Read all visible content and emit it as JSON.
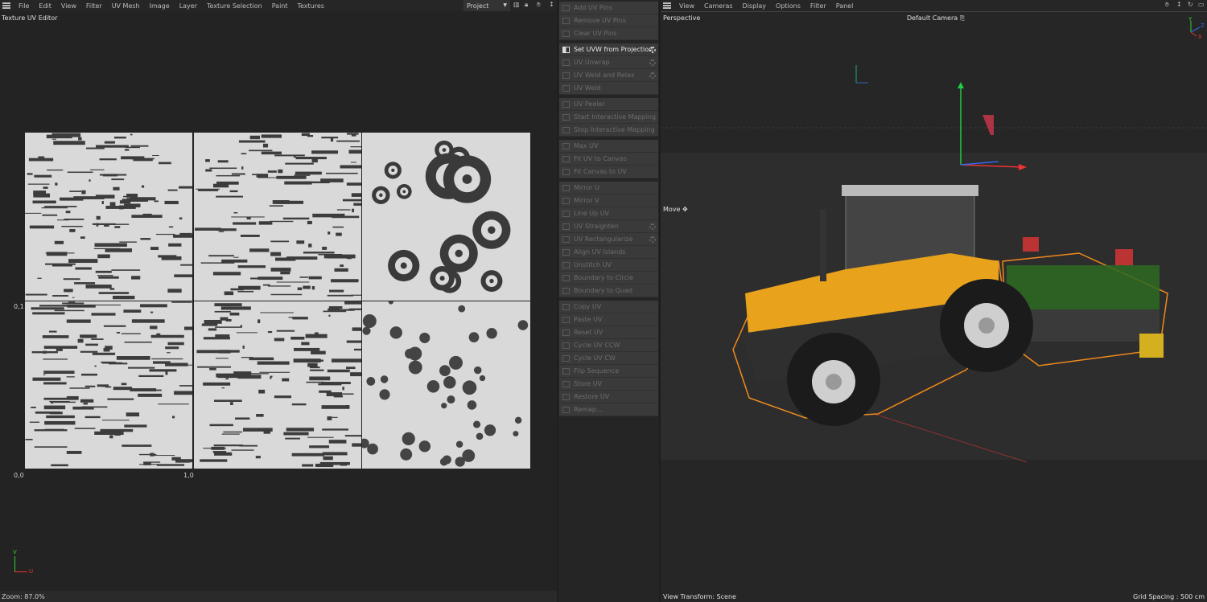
{
  "uv_editor": {
    "menu": [
      "File",
      "Edit",
      "View",
      "Filter",
      "UV Mesh",
      "Image",
      "Layer",
      "Texture Selection",
      "Paint",
      "Textures"
    ],
    "project_dropdown": "Project",
    "title": "Texture UV Editor",
    "axis_labels": {
      "origin": "0,0",
      "u_one": "1,0",
      "v_one": "0,1"
    },
    "axis_gizmo": {
      "u": "U",
      "v": "V"
    },
    "zoom": "Zoom: 87.0%"
  },
  "commands": {
    "groups": [
      [
        {
          "label": "Add UV Pins"
        },
        {
          "label": "Remove UV Pins"
        },
        {
          "label": "Clear UV Pins"
        }
      ],
      [
        {
          "label": "Set UVW from Projection",
          "active": true,
          "gear": true
        },
        {
          "label": "UV Unwrap",
          "gear": true
        },
        {
          "label": "UV Weld and Relax",
          "gear": true
        },
        {
          "label": "UV Weld"
        }
      ],
      [
        {
          "label": "UV Peeler"
        },
        {
          "label": "Start Interactive Mapping"
        },
        {
          "label": "Stop Interactive Mapping"
        }
      ],
      [
        {
          "label": "Max UV"
        },
        {
          "label": "Fit UV to Canvas"
        },
        {
          "label": "Fit Canvas to UV"
        }
      ],
      [
        {
          "label": "Mirror U"
        },
        {
          "label": "Mirror V"
        },
        {
          "label": "Line Up UV"
        },
        {
          "label": "UV Straighten",
          "gear": true
        },
        {
          "label": "UV Rectangularize",
          "gear": true
        },
        {
          "label": "Align UV Islands"
        },
        {
          "label": "Unstitch UV"
        },
        {
          "label": "Boundary to Circle"
        },
        {
          "label": "Boundary to Quad"
        }
      ],
      [
        {
          "label": "Copy UV"
        },
        {
          "label": "Paste UV"
        },
        {
          "label": "Reset UV"
        },
        {
          "label": "Cycle UV CCW"
        },
        {
          "label": "Cycle UV CW"
        },
        {
          "label": "Flip Sequence"
        },
        {
          "label": "Store UV"
        },
        {
          "label": "Restore UV"
        },
        {
          "label": "Remap..."
        }
      ]
    ]
  },
  "viewport": {
    "menu": [
      "View",
      "Cameras",
      "Display",
      "Options",
      "Filter",
      "Panel"
    ],
    "view_name": "Perspective",
    "camera": "Default Camera",
    "tool": "Move",
    "view_transform": "View Transform: Scene",
    "grid_spacing": "Grid Spacing : 500 cm",
    "axes": {
      "x": "X",
      "y": "Y",
      "z": "Z"
    },
    "colors": {
      "selection": "#f08a1c",
      "tractor_body": "#e8a21c",
      "implement": "#3d8a2a"
    }
  }
}
